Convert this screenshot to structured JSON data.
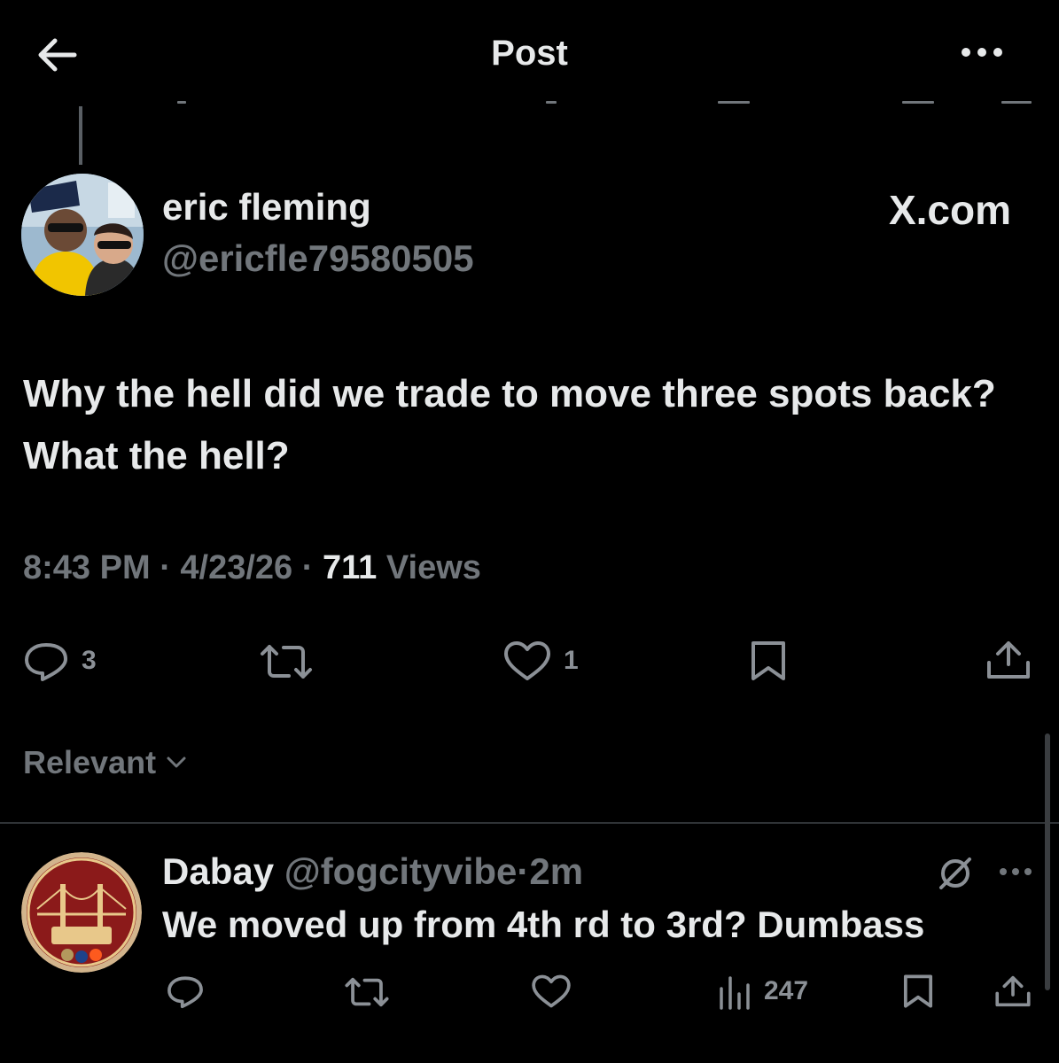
{
  "header": {
    "title": "Post"
  },
  "post": {
    "author_name": "eric fleming",
    "author_handle": "@ericfle79580505",
    "source_label": "X.com",
    "text": "Why the hell did we trade to move three spots back? What the hell?",
    "time": "8:43 PM",
    "date": "4/23/26",
    "separator": "·",
    "views_count": "711",
    "views_label": "Views",
    "stats": {
      "replies": "3",
      "likes": "1"
    }
  },
  "sort": {
    "label": "Relevant"
  },
  "reply": {
    "author_name": "Dabay",
    "author_handle": "@fogcityvibe",
    "separator": "·",
    "time": "2m",
    "text": "We moved up from 4th rd to 3rd? Dumbass",
    "views": "247"
  },
  "colors": {
    "background": "#000000",
    "primary_text": "#e7e9ea",
    "secondary_text": "#71767b",
    "divider": "#2f3336"
  },
  "icons": [
    "back-arrow-icon",
    "more-dots-icon",
    "reply-icon",
    "repost-icon",
    "like-icon",
    "bookmark-icon",
    "share-icon",
    "views-icon",
    "grok-icon",
    "chevron-down-icon"
  ]
}
